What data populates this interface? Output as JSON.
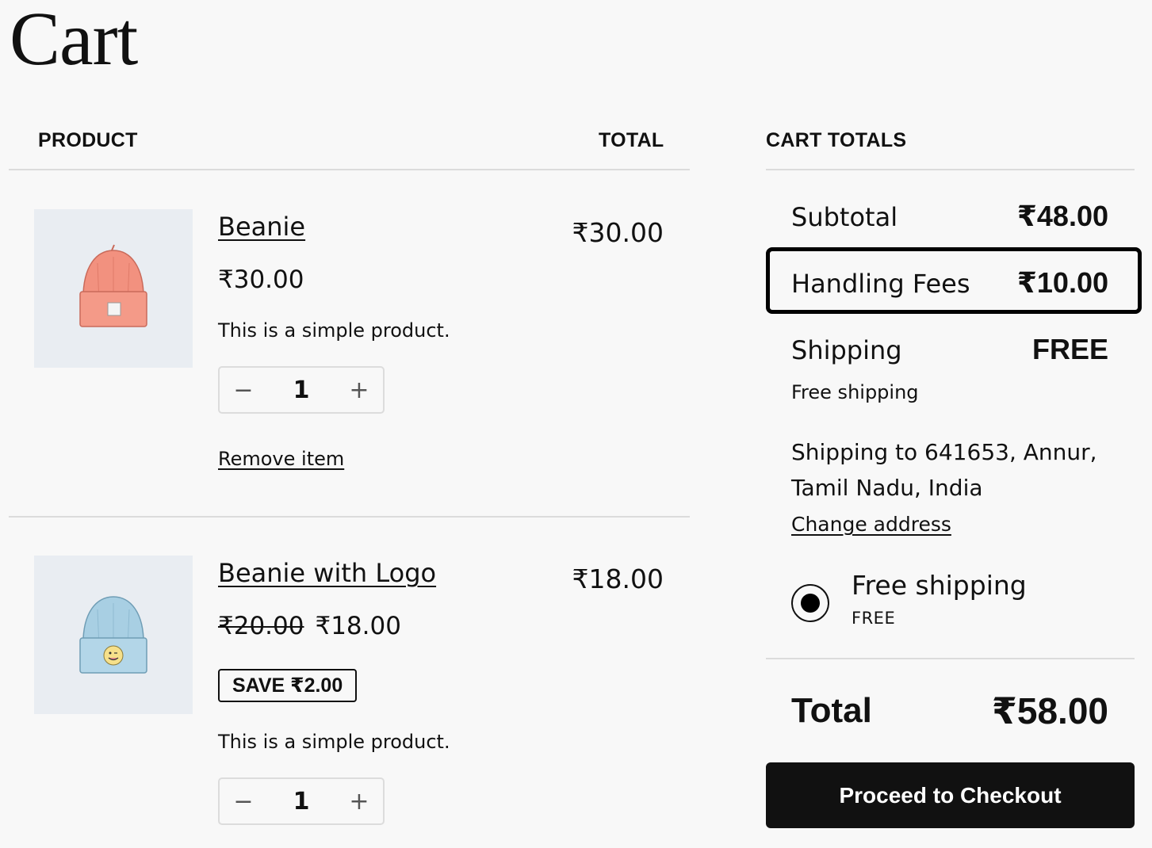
{
  "page": {
    "title": "Cart"
  },
  "table": {
    "col_product": "PRODUCT",
    "col_total": "TOTAL"
  },
  "items": [
    {
      "name": "Beanie",
      "price": "₹30.00",
      "description": "This is a simple product.",
      "quantity": "1",
      "line_total": "₹30.00",
      "remove_label": "Remove item",
      "image_icon": "beanie-icon",
      "image_color": "#f2917f"
    },
    {
      "name": "Beanie with Logo",
      "regular_price": "₹20.00",
      "sale_price": "₹18.00",
      "save_badge": "SAVE ₹2.00",
      "description": "This is a simple product.",
      "quantity": "1",
      "line_total": "₹18.00",
      "image_icon": "beanie-with-logo-icon",
      "image_color": "#a8cfe3"
    }
  ],
  "qty_controls": {
    "decrease_symbol": "−",
    "increase_symbol": "+"
  },
  "totals": {
    "heading": "CART TOTALS",
    "subtotal_label": "Subtotal",
    "subtotal_value": "₹48.00",
    "handling_label": "Handling Fees",
    "handling_value": "₹10.00",
    "shipping_label": "Shipping",
    "shipping_value": "FREE",
    "shipping_method": "Free shipping",
    "shipping_address": "Shipping to 641653, Annur, Tamil Nadu, India",
    "change_address_label": "Change address",
    "option_label": "Free shipping",
    "option_price": "FREE",
    "total_label": "Total",
    "total_value": "₹58.00",
    "checkout_label": "Proceed to Checkout"
  },
  "colors": {
    "background": "#f8f8f8",
    "text": "#111111",
    "button": "#111111",
    "divider": "#dcdcdc",
    "thumb_bg": "#e9edf2"
  }
}
